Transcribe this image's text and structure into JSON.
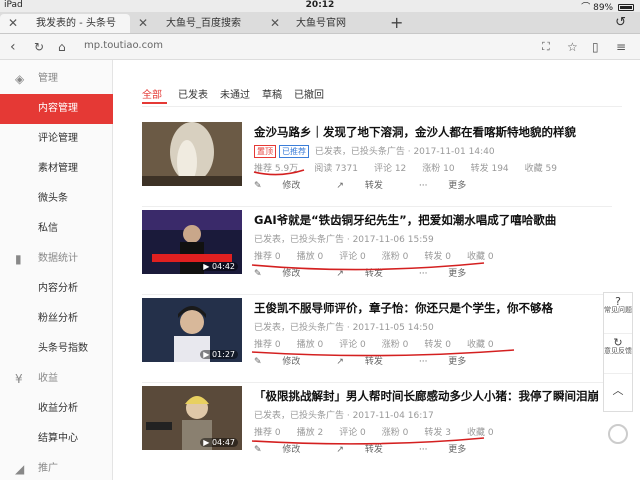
{
  "status": {
    "device": "iPad",
    "time": "20:12",
    "battery": "89%"
  },
  "tabs": [
    {
      "label": "我发表的 - 头条号"
    },
    {
      "label": "大鱼号_百度搜索"
    },
    {
      "label": "大鱼号官网"
    }
  ],
  "address": {
    "url": "mp.toutiao.com"
  },
  "sidebar": {
    "sections": [
      {
        "heading": "管理",
        "items": [
          "内容管理",
          "评论管理",
          "素材管理",
          "微头条",
          "私信"
        ]
      },
      {
        "heading": "数据统计",
        "items": [
          "内容分析",
          "粉丝分析",
          "头条号指数"
        ]
      },
      {
        "heading": "收益",
        "items": [
          "收益分析",
          "结算中心"
        ]
      },
      {
        "heading": "推广",
        "items": []
      }
    ],
    "active": "内容管理"
  },
  "filters": [
    "全部",
    "已发表",
    "未通过",
    "草稿",
    "已撤回"
  ],
  "articles": [
    {
      "title": "金沙马路乡｜发现了地下溶洞，金沙人都在看喀斯特地貌的样貌",
      "badges": [
        "置顶",
        "已推荐"
      ],
      "meta": "已发表，已投头条广告 · 2017-11-01 14:40",
      "stats": [
        "推荐 5.9万",
        "阅读 7371",
        "评论 12",
        "涨粉 10",
        "转发 194",
        "收藏 59"
      ],
      "duration": ""
    },
    {
      "title": "GAI爷就是“铁齿铜牙纪先生”，把爱如潮水唱成了嘻哈歌曲",
      "badges": [],
      "meta": "已发表，已投头条广告 · 2017-11-06 15:59",
      "stats": [
        "推荐 0",
        "播放 0",
        "评论 0",
        "涨粉 0",
        "转发 0",
        "收藏 0"
      ],
      "duration": "04:42"
    },
    {
      "title": "王俊凯不服导师评价，章子怡：你还只是个学生，你不够格",
      "badges": [],
      "meta": "已发表，已投头条广告 · 2017-11-05 14:50",
      "stats": [
        "推荐 0",
        "播放 0",
        "评论 0",
        "涨粉 0",
        "转发 0",
        "收藏 0"
      ],
      "duration": "01:27"
    },
    {
      "title": "「极限挑战解封」男人帮时间长廊感动多少人小猪：我停了瞬间泪崩",
      "badges": [],
      "meta": "已发表，已投头条广告 · 2017-11-04 16:17",
      "stats": [
        "推荐 0",
        "播放 2",
        "评论 0",
        "涨粉 0",
        "转发 3",
        "收藏 0"
      ],
      "duration": "04:47"
    }
  ],
  "actions": [
    "修改",
    "转发",
    "更多"
  ],
  "float_buttons": [
    "常见问题",
    "意见反馈"
  ],
  "colors": {
    "accent": "#e53935",
    "blue_badge": "#3b7dd8",
    "ink": "#d42020"
  }
}
